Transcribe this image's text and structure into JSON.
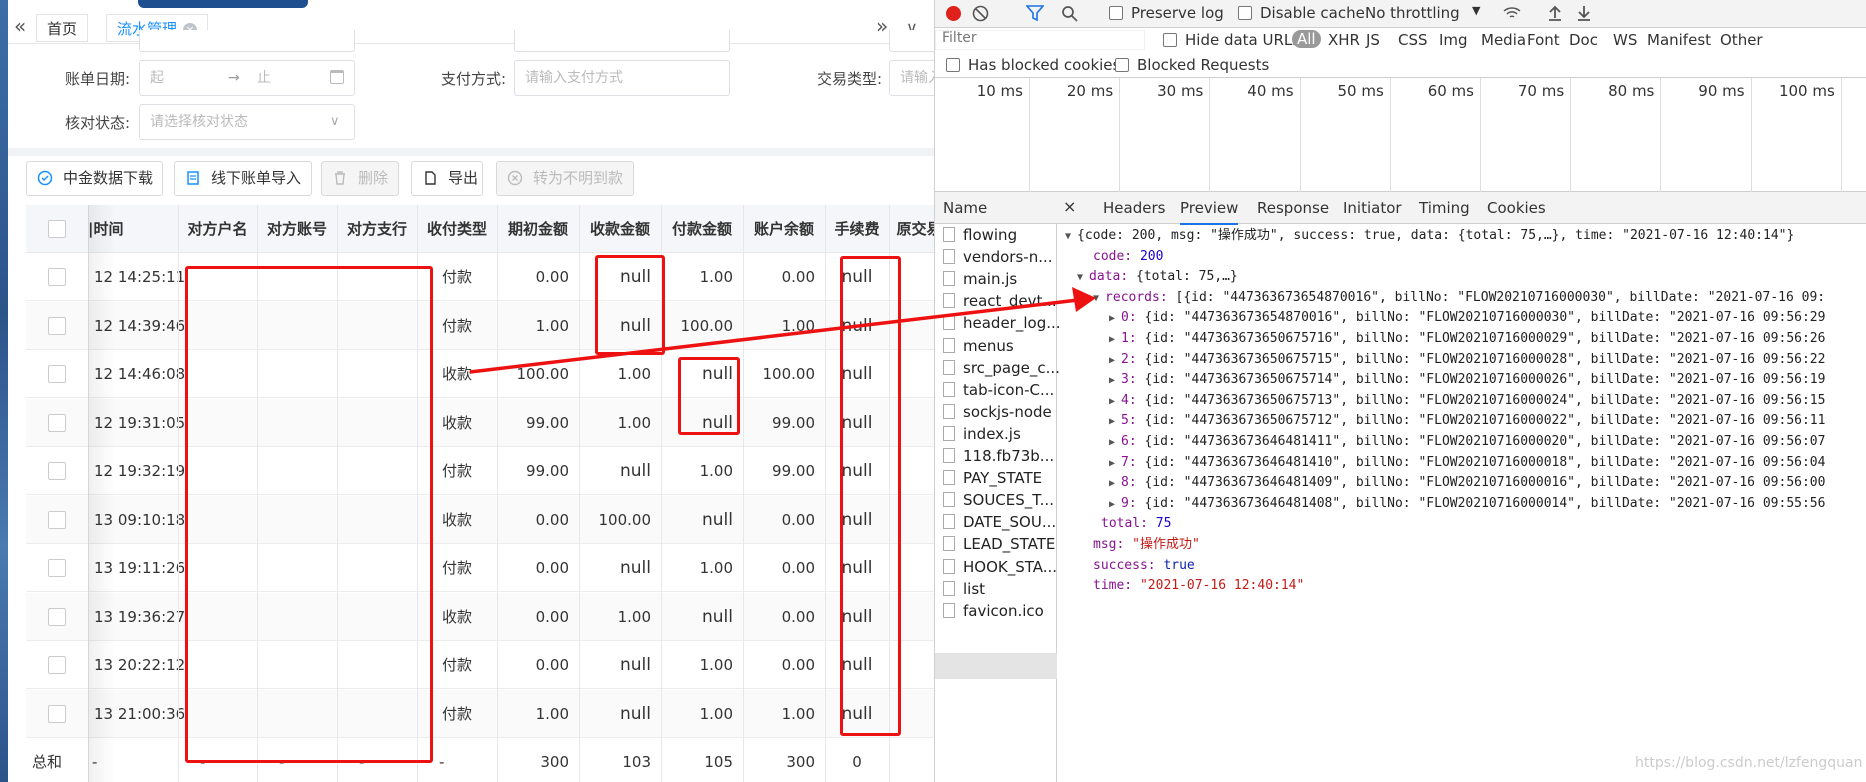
{
  "tabs": {
    "home": "首页",
    "active": "流水管理",
    "close": "×"
  },
  "filters": {
    "bill_date_label": "账单日期:",
    "bill_date_start": "起",
    "bill_date_arrow": "→",
    "bill_date_end": "止",
    "pay_method_label": "支付方式:",
    "pay_method_placeholder": "请输入支付方式",
    "trade_type_label": "交易类型:",
    "trade_type_placeholder": "请输入",
    "check_status_label": "核对状态:",
    "check_status_placeholder": "请选择核对状态"
  },
  "toolbar": {
    "download": "中金数据下载",
    "import": "线下账单导入",
    "delete": "删除",
    "export": "导出",
    "convert": "转为不明到款"
  },
  "table": {
    "headers": [
      "|时间",
      "对方户名",
      "对方账号",
      "对方支行",
      "收付类型",
      "期初金额",
      "收款金额",
      "付款金额",
      "账户余额",
      "手续费",
      "原交易"
    ],
    "rows": [
      {
        "time": "12 14:25:11",
        "type": "付款",
        "opening": "0.00",
        "received": "null",
        "paid": "1.00",
        "balance": "0.00",
        "fee": "null"
      },
      {
        "time": "12 14:39:46",
        "type": "付款",
        "opening": "1.00",
        "received": "null",
        "paid": "100.00",
        "balance": "1.00",
        "fee": "null"
      },
      {
        "time": "12 14:46:08",
        "type": "收款",
        "opening": "100.00",
        "received": "1.00",
        "paid": "null",
        "balance": "100.00",
        "fee": "null"
      },
      {
        "time": "12 19:31:05",
        "type": "收款",
        "opening": "99.00",
        "received": "1.00",
        "paid": "null",
        "balance": "99.00",
        "fee": "null"
      },
      {
        "time": "12 19:32:19",
        "type": "付款",
        "opening": "99.00",
        "received": "null",
        "paid": "1.00",
        "balance": "99.00",
        "fee": "null"
      },
      {
        "time": "13 09:10:18",
        "type": "收款",
        "opening": "0.00",
        "received": "100.00",
        "paid": "null",
        "balance": "0.00",
        "fee": "null"
      },
      {
        "time": "13 19:11:26",
        "type": "付款",
        "opening": "0.00",
        "received": "null",
        "paid": "1.00",
        "balance": "0.00",
        "fee": "null"
      },
      {
        "time": "13 19:36:27",
        "type": "收款",
        "opening": "0.00",
        "received": "1.00",
        "paid": "null",
        "balance": "0.00",
        "fee": "null"
      },
      {
        "time": "13 20:22:12",
        "type": "付款",
        "opening": "0.00",
        "received": "null",
        "paid": "1.00",
        "balance": "0.00",
        "fee": "null"
      },
      {
        "time": "13 21:00:36",
        "type": "付款",
        "opening": "1.00",
        "received": "null",
        "paid": "1.00",
        "balance": "1.00",
        "fee": "null"
      }
    ],
    "total": {
      "label": "总和",
      "time": "-",
      "name": "-",
      "account": "-",
      "branch": "-",
      "type": "-",
      "opening": "300",
      "received": "103",
      "paid": "105",
      "balance": "300",
      "fee": "0"
    }
  },
  "devtools": {
    "preserve_log": "Preserve log",
    "disable_cache": "Disable cache",
    "throttling": "No throttling",
    "filter_placeholder": "Filter",
    "hide_data_urls": "Hide data URLs",
    "type_filters": [
      "All",
      "XHR",
      "JS",
      "CSS",
      "Img",
      "Media",
      "Font",
      "Doc",
      "WS",
      "Manifest",
      "Other"
    ],
    "has_blocked_cookies": "Has blocked cookies",
    "blocked_requests": "Blocked Requests",
    "timeline_ticks": [
      "10 ms",
      "20 ms",
      "30 ms",
      "40 ms",
      "50 ms",
      "60 ms",
      "70 ms",
      "80 ms",
      "90 ms",
      "100 ms"
    ],
    "name_header": "Name",
    "requests": [
      "flowing",
      "vendors-n...",
      "main.js",
      "react_devt...",
      "header_log...",
      "menus",
      "src_page_c...",
      "tab-icon-C...",
      "sockjs-node",
      "index.js",
      "118.fb73b...",
      "PAY_STATE",
      "SOUCES_T...",
      "DATE_SOU...",
      "LEAD_STATE",
      "HOOK_STA...",
      "list",
      "favicon.ico"
    ],
    "panel_tabs": [
      "Headers",
      "Preview",
      "Response",
      "Initiator",
      "Timing",
      "Cookies"
    ],
    "active_panel_tab": "Preview",
    "close": "×",
    "json_lines": [
      "{code: 200, msg: \"操作成功\", success: true, data: {total: 75,…}, time: \"2021-07-16 12:40:14\"}",
      "code: 200",
      "data: {total: 75,…}",
      "records: [{id: \"447363673654870016\", billNo: \"FLOW20210716000030\", billDate: \"2021-07-16 09:",
      "0: {id: \"447363673654870016\", billNo: \"FLOW20210716000030\", billDate: \"2021-07-16 09:56:29",
      "1: {id: \"447363673650675716\", billNo: \"FLOW20210716000029\", billDate: \"2021-07-16 09:56:26",
      "2: {id: \"447363673650675715\", billNo: \"FLOW20210716000028\", billDate: \"2021-07-16 09:56:22",
      "3: {id: \"447363673650675714\", billNo: \"FLOW20210716000026\", billDate: \"2021-07-16 09:56:19",
      "4: {id: \"447363673650675713\", billNo: \"FLOW20210716000024\", billDate: \"2021-07-16 09:56:15",
      "5: {id: \"447363673650675712\", billNo: \"FLOW20210716000022\", billDate: \"2021-07-16 09:56:11",
      "6: {id: \"447363673646481411\", billNo: \"FLOW20210716000020\", billDate: \"2021-07-16 09:56:07",
      "7: {id: \"447363673646481410\", billNo: \"FLOW20210716000018\", billDate: \"2021-07-16 09:56:04",
      "8: {id: \"447363673646481409\", billNo: \"FLOW20210716000016\", billDate: \"2021-07-16 09:56:00",
      "9: {id: \"447363673646481408\", billNo: \"FLOW20210716000014\", billDate: \"2021-07-16 09:55:56",
      "total: 75",
      "msg: \"操作成功\"",
      "success: true",
      "time: \"2021-07-16 12:40:14\""
    ]
  },
  "watermark": "https://blog.csdn.net/lzfengquan",
  "colors": {
    "accent": "#1890ff",
    "annotation": "#ee1111",
    "record": "#cc0000"
  }
}
